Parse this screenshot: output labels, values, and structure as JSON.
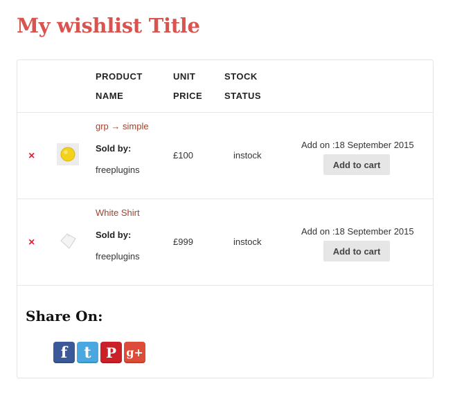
{
  "title": "My wishlist Title",
  "columns": {
    "product_line1": "PRODUCT",
    "product_line2": "NAME",
    "price_line1": "UNIT",
    "price_line2": "PRICE",
    "stock_line1": "STOCK",
    "stock_line2": "STATUS"
  },
  "items": [
    {
      "remove": "×",
      "thumb_icon": "yellow-pill-icon",
      "name": "grp → simple",
      "sold_by_label": "Sold by:",
      "vendor": "freeplugins",
      "price": "£100",
      "stock": "instock",
      "added": "Add on :18 September 2015",
      "cart_label": "Add to cart"
    },
    {
      "remove": "×",
      "thumb_icon": "white-shirt-icon",
      "name": "White Shirt",
      "sold_by_label": "Sold by:",
      "vendor": "freeplugins",
      "price": "£999",
      "stock": "instock",
      "added": "Add on :18 September 2015",
      "cart_label": "Add to cart"
    }
  ],
  "share": {
    "title": "Share On:",
    "icons": [
      {
        "name": "facebook-icon",
        "glyph": "f",
        "color": "#3b5998"
      },
      {
        "name": "twitter-icon",
        "glyph": "t",
        "color": "#4aa8e0"
      },
      {
        "name": "pinterest-icon",
        "glyph": "P",
        "color": "#cb2027"
      },
      {
        "name": "googleplus-icon",
        "glyph": "g+",
        "color": "#dd4b39"
      }
    ]
  },
  "colors": {
    "title": "#d9534f",
    "link": "#a0412b",
    "remove": "#e0223a",
    "button_bg": "#e6e6e6"
  }
}
